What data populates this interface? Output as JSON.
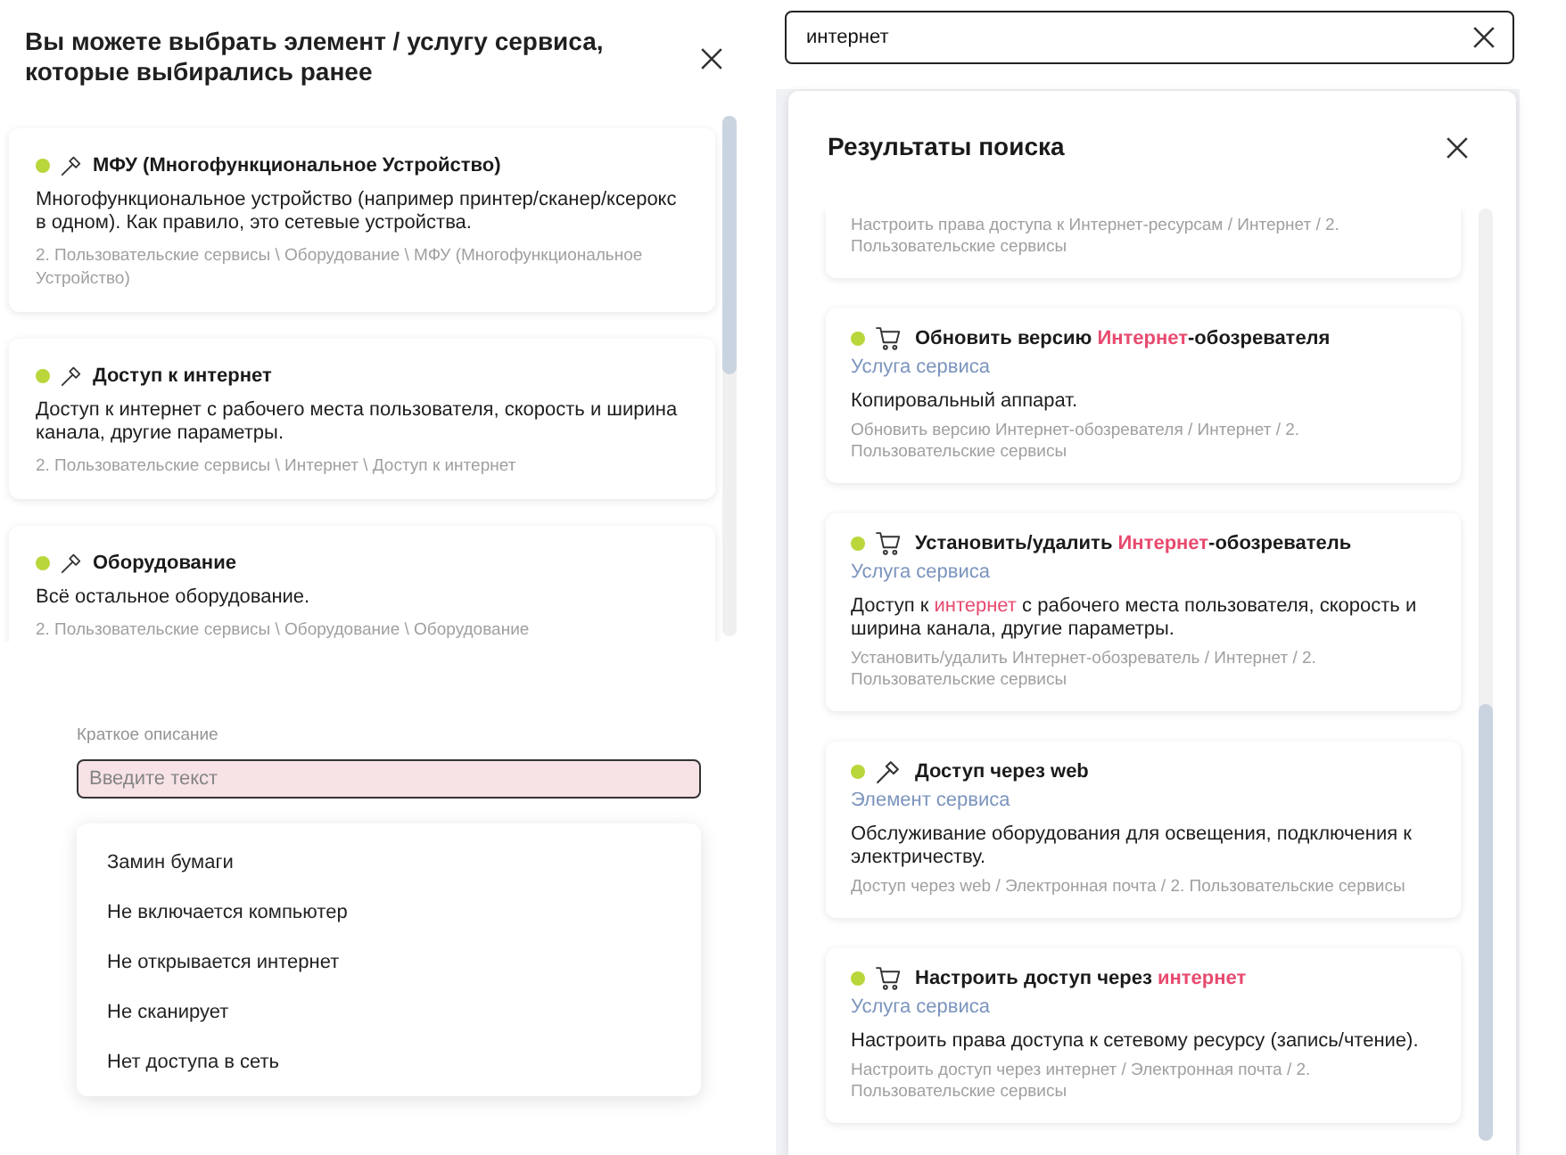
{
  "previous_selection": {
    "title": "Вы можете выбрать элемент / услугу сервиса, которые выбирались ранее",
    "cards": [
      {
        "kind": "element",
        "title": "МФУ (Многофункциональное Устройство)",
        "description": "Многофункциональное устройство (например принтер/сканер/ксерокс в одном). Как правило, это сетевые устройства.",
        "path": "2. Пользовательские сервисы \\ Оборудование \\ МФУ (Многофункциональное Устройство)"
      },
      {
        "kind": "element",
        "title": "Доступ к интернет",
        "description": "Доступ к интернет с рабочего места пользователя, скорость и ширина канала, другие параметры.",
        "path": "2. Пользовательские сервисы \\ Интернет \\ Доступ к интернет"
      },
      {
        "kind": "element",
        "title": "Оборудование",
        "description": "Всё остальное оборудование.",
        "path": "2. Пользовательские сервисы \\ Оборудование \\ Оборудование"
      }
    ]
  },
  "short_description": {
    "label": "Краткое описание",
    "placeholder": "Введите текст",
    "invalid": true,
    "options": [
      {
        "label": "Замин бумаги",
        "selected": false
      },
      {
        "label": "Не включается компьютер",
        "selected": false
      },
      {
        "label": "Не открывается интернет",
        "selected": false
      },
      {
        "label": "Не сканирует",
        "selected": false
      },
      {
        "label": "Нет доступа в сеть",
        "selected": false
      }
    ]
  },
  "search": {
    "value": "интернет"
  },
  "search_results": {
    "title": "Результаты поиска",
    "results": [
      {
        "path": "Настроить права доступа к Интернет-ресурсам / Интернет / 2. Пользовательские сервисы"
      },
      {
        "kind": "service",
        "title": [
          {
            "text": "Обновить версию ",
            "highlighted": false
          },
          {
            "text": "Интернет",
            "highlighted": true
          },
          {
            "text": "-обозревателя",
            "highlighted": false
          }
        ],
        "type_label": "Услуга сервиса",
        "description": [
          {
            "text": "Копировальный аппарат.",
            "highlighted": false
          }
        ],
        "path": "Обновить версию Интернет-обозревателя / Интернет / 2. Пользовательские сервисы"
      },
      {
        "kind": "service",
        "title": [
          {
            "text": "Установить/удалить ",
            "highlighted": false
          },
          {
            "text": "Интернет",
            "highlighted": true
          },
          {
            "text": "-обозреватель",
            "highlighted": false
          }
        ],
        "type_label": "Услуга сервиса",
        "description": [
          {
            "text": "Доступ к ",
            "highlighted": false
          },
          {
            "text": "интернет",
            "highlighted": true
          },
          {
            "text": " с рабочего места пользователя, скорость и ширина канала, другие параметры.",
            "highlighted": false
          }
        ],
        "path": "Установить/удалить Интернет-обозреватель / Интернет / 2. Пользовательские сервисы"
      },
      {
        "kind": "element",
        "title": [
          {
            "text": "Доступ через web",
            "highlighted": false
          }
        ],
        "type_label": "Элемент сервиса",
        "description": [
          {
            "text": "Обслуживание оборудования для освещения, подключения к электричеству.",
            "highlighted": false
          }
        ],
        "path": "Доступ через web / Электронная почта / 2. Пользовательские сервисы"
      },
      {
        "kind": "service",
        "title": [
          {
            "text": "Настроить доступ через ",
            "highlighted": false
          },
          {
            "text": "интернет",
            "highlighted": true
          }
        ],
        "type_label": "Услуга сервиса",
        "description": [
          {
            "text": "Настроить права доступа к сетевому ресурсу (запись/чтение).",
            "highlighted": false
          }
        ],
        "path": "Настроить доступ через интернет / Электронная почта / 2. Пользовательские сервисы"
      }
    ]
  }
}
